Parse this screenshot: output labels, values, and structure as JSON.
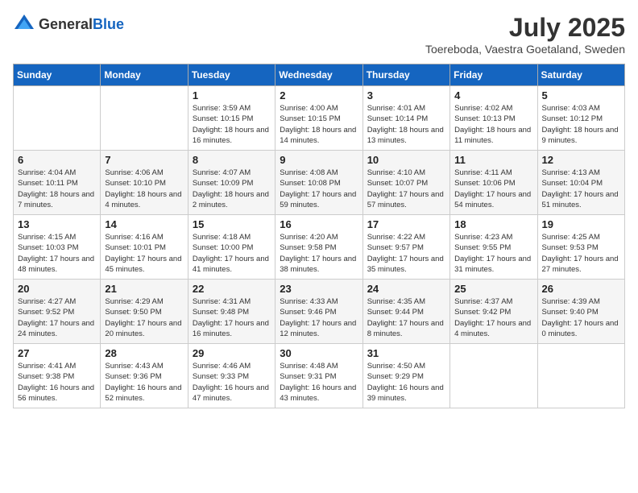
{
  "logo": {
    "text_general": "General",
    "text_blue": "Blue"
  },
  "title": {
    "month_year": "July 2025",
    "location": "Toereboda, Vaestra Goetaland, Sweden"
  },
  "weekdays": [
    "Sunday",
    "Monday",
    "Tuesday",
    "Wednesday",
    "Thursday",
    "Friday",
    "Saturday"
  ],
  "weeks": [
    [
      {
        "day": "",
        "info": ""
      },
      {
        "day": "",
        "info": ""
      },
      {
        "day": "1",
        "info": "Sunrise: 3:59 AM\nSunset: 10:15 PM\nDaylight: 18 hours and 16 minutes."
      },
      {
        "day": "2",
        "info": "Sunrise: 4:00 AM\nSunset: 10:15 PM\nDaylight: 18 hours and 14 minutes."
      },
      {
        "day": "3",
        "info": "Sunrise: 4:01 AM\nSunset: 10:14 PM\nDaylight: 18 hours and 13 minutes."
      },
      {
        "day": "4",
        "info": "Sunrise: 4:02 AM\nSunset: 10:13 PM\nDaylight: 18 hours and 11 minutes."
      },
      {
        "day": "5",
        "info": "Sunrise: 4:03 AM\nSunset: 10:12 PM\nDaylight: 18 hours and 9 minutes."
      }
    ],
    [
      {
        "day": "6",
        "info": "Sunrise: 4:04 AM\nSunset: 10:11 PM\nDaylight: 18 hours and 7 minutes."
      },
      {
        "day": "7",
        "info": "Sunrise: 4:06 AM\nSunset: 10:10 PM\nDaylight: 18 hours and 4 minutes."
      },
      {
        "day": "8",
        "info": "Sunrise: 4:07 AM\nSunset: 10:09 PM\nDaylight: 18 hours and 2 minutes."
      },
      {
        "day": "9",
        "info": "Sunrise: 4:08 AM\nSunset: 10:08 PM\nDaylight: 17 hours and 59 minutes."
      },
      {
        "day": "10",
        "info": "Sunrise: 4:10 AM\nSunset: 10:07 PM\nDaylight: 17 hours and 57 minutes."
      },
      {
        "day": "11",
        "info": "Sunrise: 4:11 AM\nSunset: 10:06 PM\nDaylight: 17 hours and 54 minutes."
      },
      {
        "day": "12",
        "info": "Sunrise: 4:13 AM\nSunset: 10:04 PM\nDaylight: 17 hours and 51 minutes."
      }
    ],
    [
      {
        "day": "13",
        "info": "Sunrise: 4:15 AM\nSunset: 10:03 PM\nDaylight: 17 hours and 48 minutes."
      },
      {
        "day": "14",
        "info": "Sunrise: 4:16 AM\nSunset: 10:01 PM\nDaylight: 17 hours and 45 minutes."
      },
      {
        "day": "15",
        "info": "Sunrise: 4:18 AM\nSunset: 10:00 PM\nDaylight: 17 hours and 41 minutes."
      },
      {
        "day": "16",
        "info": "Sunrise: 4:20 AM\nSunset: 9:58 PM\nDaylight: 17 hours and 38 minutes."
      },
      {
        "day": "17",
        "info": "Sunrise: 4:22 AM\nSunset: 9:57 PM\nDaylight: 17 hours and 35 minutes."
      },
      {
        "day": "18",
        "info": "Sunrise: 4:23 AM\nSunset: 9:55 PM\nDaylight: 17 hours and 31 minutes."
      },
      {
        "day": "19",
        "info": "Sunrise: 4:25 AM\nSunset: 9:53 PM\nDaylight: 17 hours and 27 minutes."
      }
    ],
    [
      {
        "day": "20",
        "info": "Sunrise: 4:27 AM\nSunset: 9:52 PM\nDaylight: 17 hours and 24 minutes."
      },
      {
        "day": "21",
        "info": "Sunrise: 4:29 AM\nSunset: 9:50 PM\nDaylight: 17 hours and 20 minutes."
      },
      {
        "day": "22",
        "info": "Sunrise: 4:31 AM\nSunset: 9:48 PM\nDaylight: 17 hours and 16 minutes."
      },
      {
        "day": "23",
        "info": "Sunrise: 4:33 AM\nSunset: 9:46 PM\nDaylight: 17 hours and 12 minutes."
      },
      {
        "day": "24",
        "info": "Sunrise: 4:35 AM\nSunset: 9:44 PM\nDaylight: 17 hours and 8 minutes."
      },
      {
        "day": "25",
        "info": "Sunrise: 4:37 AM\nSunset: 9:42 PM\nDaylight: 17 hours and 4 minutes."
      },
      {
        "day": "26",
        "info": "Sunrise: 4:39 AM\nSunset: 9:40 PM\nDaylight: 17 hours and 0 minutes."
      }
    ],
    [
      {
        "day": "27",
        "info": "Sunrise: 4:41 AM\nSunset: 9:38 PM\nDaylight: 16 hours and 56 minutes."
      },
      {
        "day": "28",
        "info": "Sunrise: 4:43 AM\nSunset: 9:36 PM\nDaylight: 16 hours and 52 minutes."
      },
      {
        "day": "29",
        "info": "Sunrise: 4:46 AM\nSunset: 9:33 PM\nDaylight: 16 hours and 47 minutes."
      },
      {
        "day": "30",
        "info": "Sunrise: 4:48 AM\nSunset: 9:31 PM\nDaylight: 16 hours and 43 minutes."
      },
      {
        "day": "31",
        "info": "Sunrise: 4:50 AM\nSunset: 9:29 PM\nDaylight: 16 hours and 39 minutes."
      },
      {
        "day": "",
        "info": ""
      },
      {
        "day": "",
        "info": ""
      }
    ]
  ]
}
